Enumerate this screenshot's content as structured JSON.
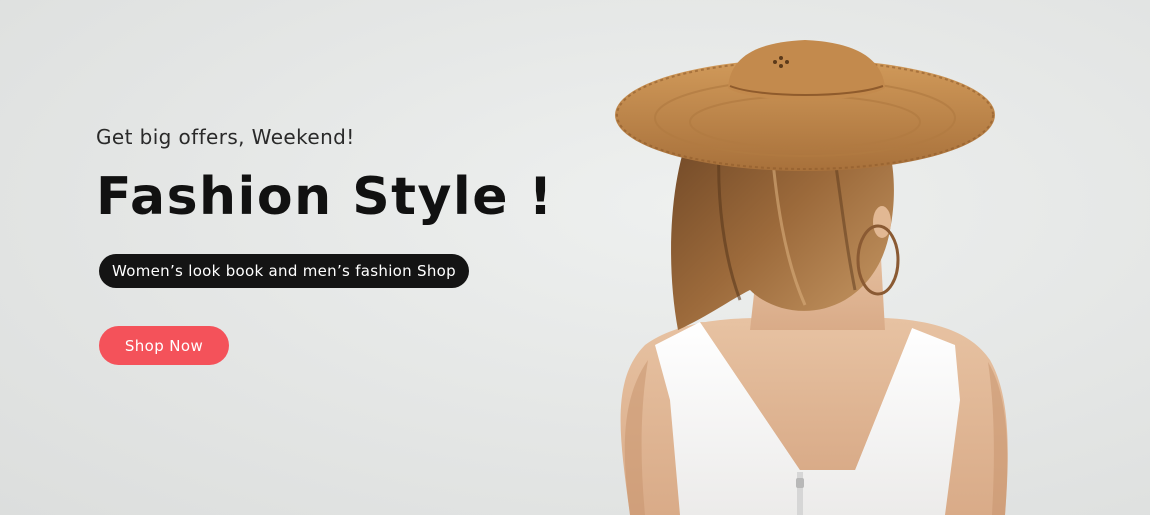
{
  "hero": {
    "subtitle": "Get big offers, Weekend!",
    "title": "Fashion Style !",
    "tagline": "Women’s look book and men’s fashion Shop",
    "cta_label": "Shop Now",
    "image": "woman-in-straw-hat-illustration"
  },
  "colors": {
    "background": "#e6e8e7",
    "cta": "#f4525a",
    "pill": "#141414",
    "title": "#111111"
  }
}
